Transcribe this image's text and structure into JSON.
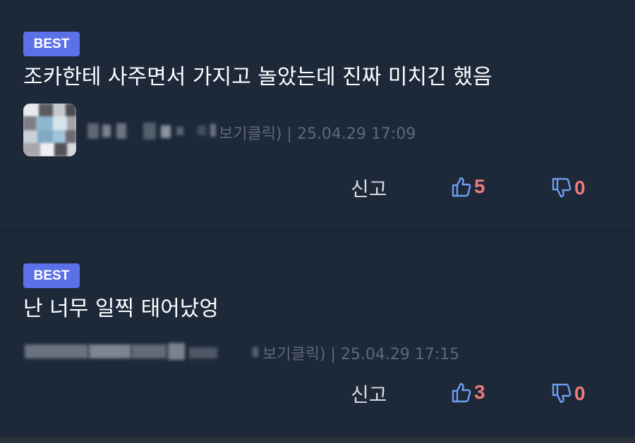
{
  "comments": [
    {
      "badge": "BEST",
      "text": "조카한테 사주면서 가지고 놀았는데 진짜 미치긴 했음",
      "meta": "보기클릭) | 25.04.29 17:09",
      "report": "신고",
      "likes": "5",
      "dislikes": "0"
    },
    {
      "badge": "BEST",
      "text": "난 너무 일찍 태어났엉",
      "meta": "보기클릭) | 25.04.29 17:15",
      "report": "신고",
      "likes": "3",
      "dislikes": "0"
    }
  ],
  "icons": {
    "like": "thumbs-up-icon",
    "dislike": "thumbs-down-icon"
  },
  "colors": {
    "background": "#1d2839",
    "badge": "#5c71e8",
    "count": "#ef7a7a",
    "like_icon": "#6f9ef0",
    "meta": "#5e6877"
  }
}
